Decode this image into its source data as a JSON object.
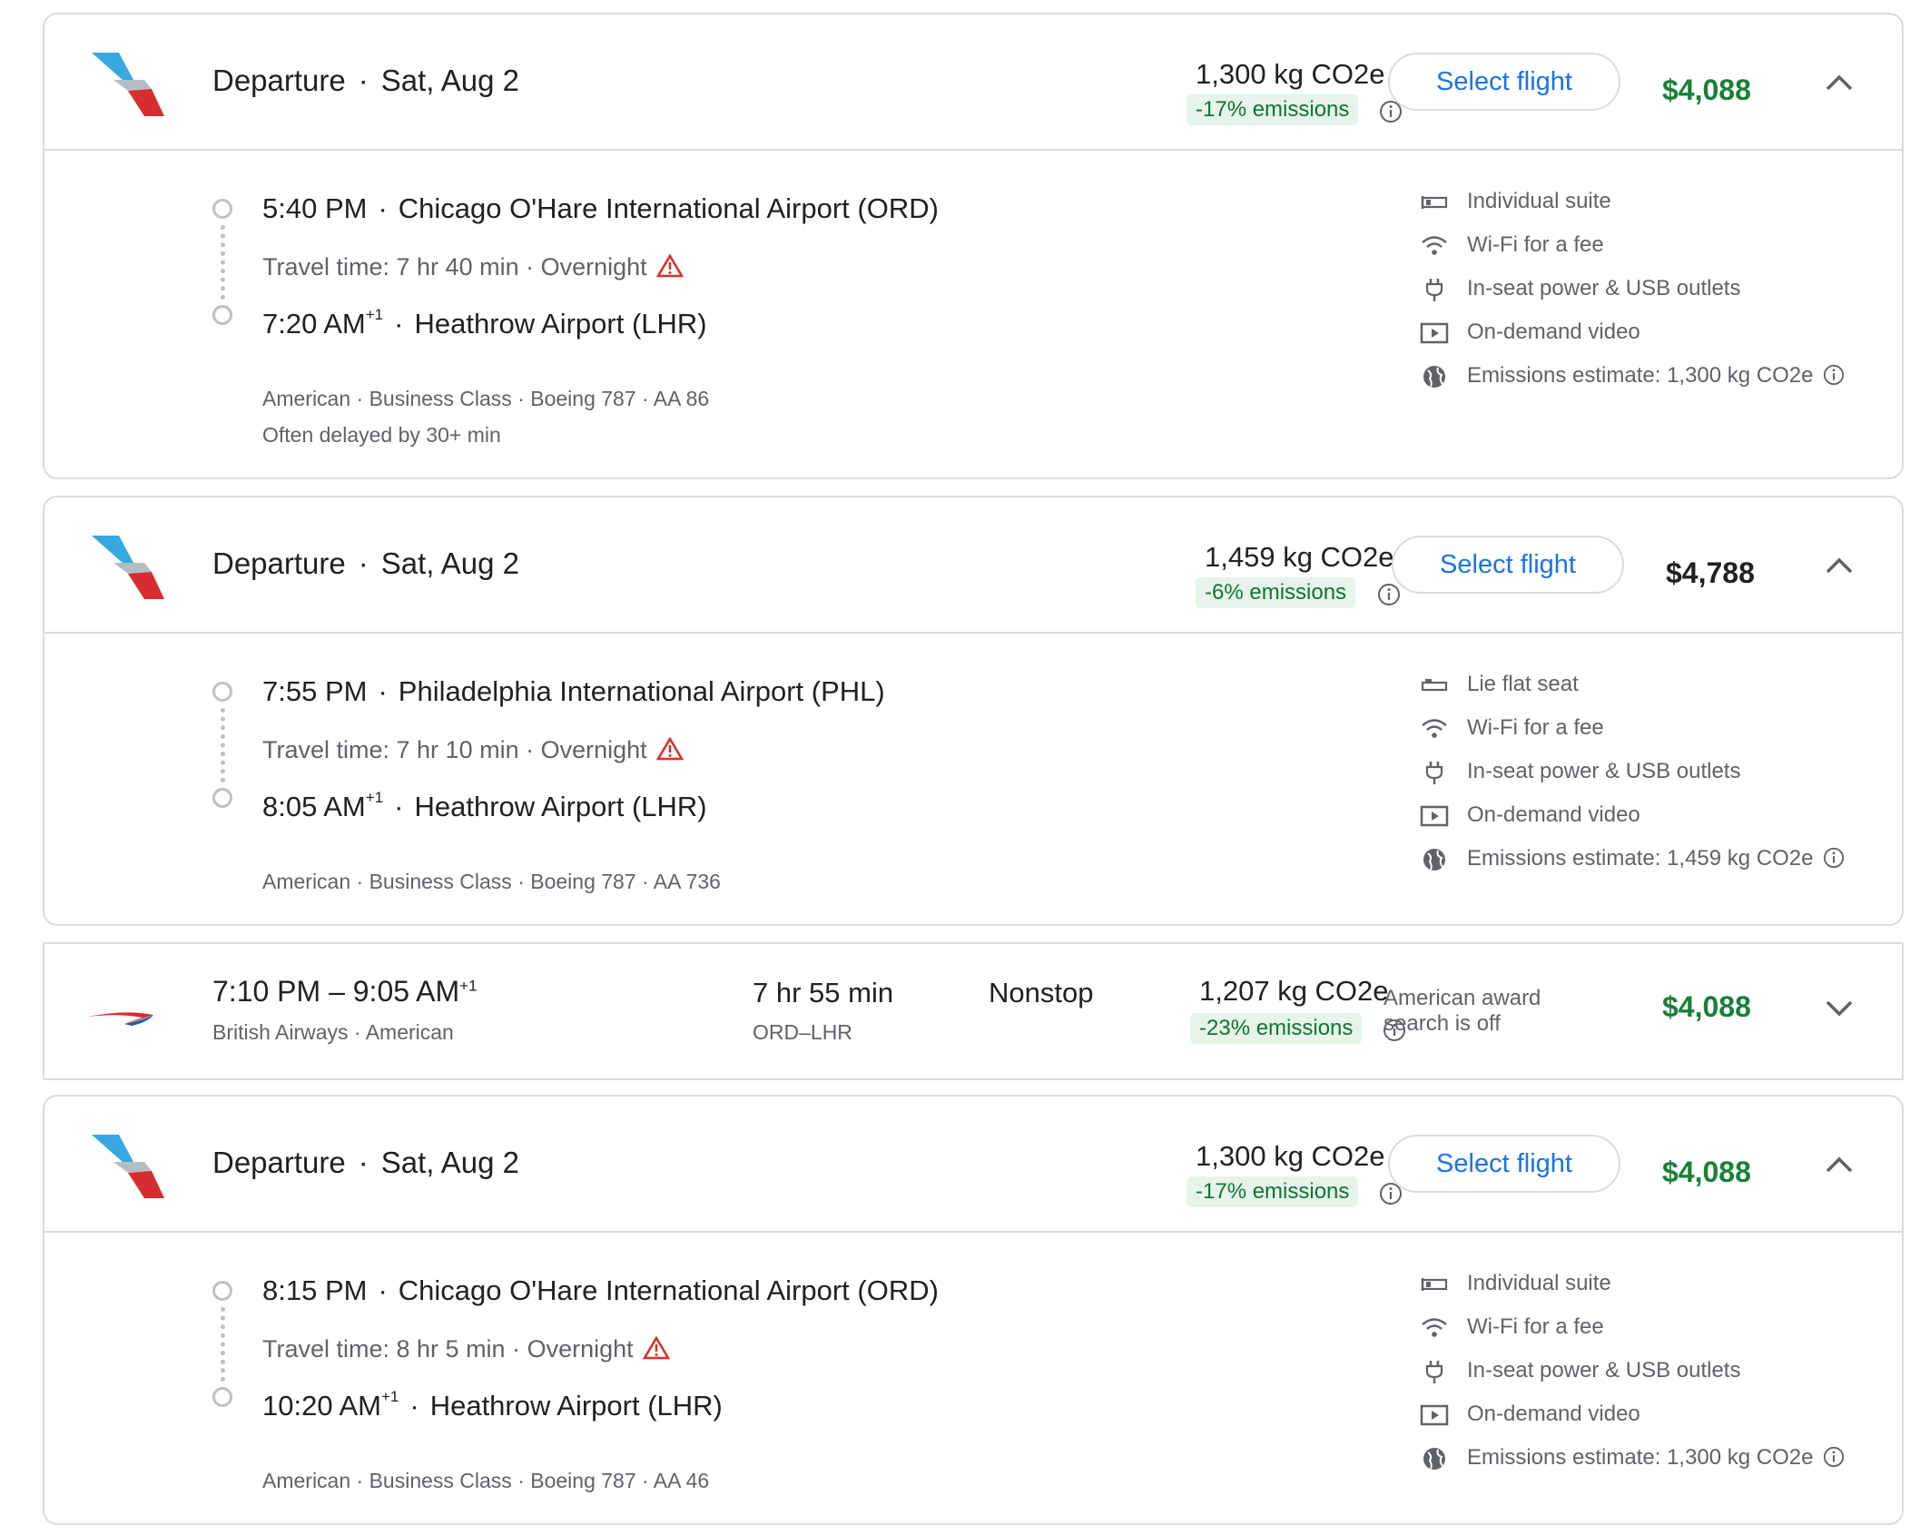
{
  "cards": [
    {
      "header": {
        "title": "Departure",
        "date": "Sat, Aug 2",
        "co2": "1,300 kg CO2e",
        "emissions": "-17% emissions",
        "select_label": "Select flight",
        "price": "$4,088",
        "price_color": "#188038"
      },
      "depart_time": "5:40 PM",
      "depart_airport": "Chicago O'Hare International Airport (ORD)",
      "travel_time": "Travel time: 7 hr 40 min · Overnight",
      "arrive_time": "7:20 AM",
      "arrive_sup": "+1",
      "arrive_airport": "Heathrow Airport (LHR)",
      "meta": "American · Business Class · Boeing 787 · AA 86",
      "meta2": "Often delayed by 30+ min",
      "amenities": [
        "Individual suite",
        "Wi-Fi for a fee",
        "In-seat power & USB outlets",
        "On-demand video",
        "Emissions estimate: 1,300 kg CO2e"
      ]
    },
    {
      "header": {
        "title": "Departure",
        "date": "Sat, Aug 2",
        "co2": "1,459 kg CO2e",
        "emissions": "-6% emissions",
        "select_label": "Select flight",
        "price": "$4,788",
        "price_color": "#202124"
      },
      "depart_time": "7:55 PM",
      "depart_airport": "Philadelphia International Airport (PHL)",
      "travel_time": "Travel time: 7 hr 10 min · Overnight",
      "arrive_time": "8:05 AM",
      "arrive_sup": "+1",
      "arrive_airport": "Heathrow Airport (LHR)",
      "meta": "American · Business Class · Boeing 787 · AA 736",
      "amenities": [
        "Lie flat seat",
        "Wi-Fi for a fee",
        "In-seat power & USB outlets",
        "On-demand video",
        "Emissions estimate: 1,459 kg CO2e"
      ]
    },
    {
      "header": {
        "title": "Departure",
        "date": "Sat, Aug 2",
        "co2": "1,300 kg CO2e",
        "emissions": "-17% emissions",
        "select_label": "Select flight",
        "price": "$4,088",
        "price_color": "#188038"
      },
      "depart_time": "8:15 PM",
      "depart_airport": "Chicago O'Hare International Airport (ORD)",
      "travel_time": "Travel time: 8 hr 5 min · Overnight",
      "arrive_time": "10:20 AM",
      "arrive_sup": "+1",
      "arrive_airport": "Heathrow Airport (LHR)",
      "meta": "American · Business Class · Boeing 787 · AA 46",
      "amenities": [
        "Individual suite",
        "Wi-Fi for a fee",
        "In-seat power & USB outlets",
        "On-demand video",
        "Emissions estimate: 1,300 kg CO2e"
      ]
    }
  ],
  "row": {
    "times": "7:10 PM – 9:05 AM",
    "sup": "+1",
    "airlines": "British Airways · American",
    "duration": "7 hr 55 min",
    "route": "ORD–LHR",
    "stops": "Nonstop",
    "co2": "1,207 kg CO2e",
    "emissions": "-23% emissions",
    "award_note": "American award search is off",
    "price": "$4,088"
  },
  "colors": {
    "accent": "#1a73e8",
    "price_green": "#188038",
    "emission_bg": "#e6f4ea",
    "emission_text": "#137333",
    "warning": "#d93025"
  }
}
